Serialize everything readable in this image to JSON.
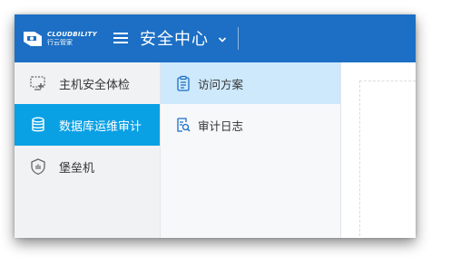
{
  "header": {
    "logo": {
      "text_en": "CLOUDBILITY",
      "text_cn": "行云管家"
    },
    "title": "安全中心",
    "menu_icon": "hamburger-menu-icon",
    "dropdown_icon": "chevron-down-icon"
  },
  "sidebar": {
    "items": [
      {
        "label": "主机安全体检",
        "icon": "host-check-icon",
        "active": false
      },
      {
        "label": "数据库运维审计",
        "icon": "database-icon",
        "active": true
      },
      {
        "label": "堡垒机",
        "icon": "shield-icon",
        "active": false
      }
    ]
  },
  "subnav": {
    "items": [
      {
        "label": "访问方案",
        "icon": "clipboard-icon",
        "active": true
      },
      {
        "label": "审计日志",
        "icon": "log-search-icon",
        "active": false
      }
    ]
  },
  "colors": {
    "header_bg": "#1c6fc4",
    "active_sidebar": "#0aa0e4",
    "active_subnav": "#cde9fb"
  }
}
